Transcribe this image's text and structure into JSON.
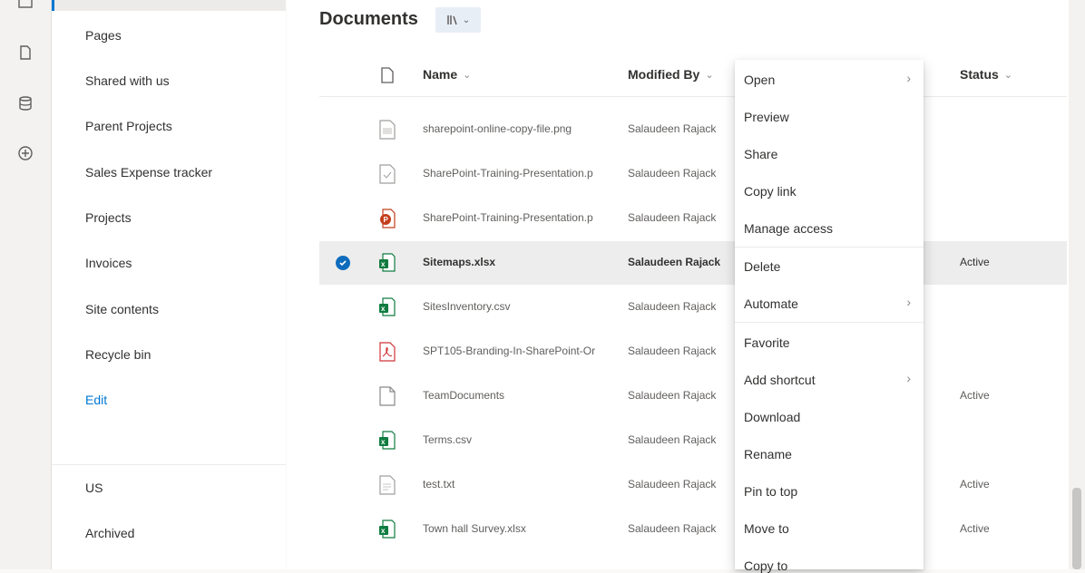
{
  "leftnav": {
    "items": [
      {
        "label": "Pages"
      },
      {
        "label": "Shared with us"
      },
      {
        "label": "Parent Projects"
      },
      {
        "label": "Sales Expense tracker"
      },
      {
        "label": "Projects"
      },
      {
        "label": "Invoices"
      },
      {
        "label": "Site contents"
      },
      {
        "label": "Recycle bin"
      },
      {
        "label": "Edit"
      }
    ],
    "bottom_items": [
      {
        "label": "US"
      },
      {
        "label": "Archived"
      }
    ]
  },
  "library": {
    "title": "Documents",
    "columns": {
      "name": "Name",
      "modified_by": "Modified By",
      "status": "Status"
    },
    "rows": [
      {
        "name": "sharepoint-online-copy-file.png",
        "modified_by": "Salaudeen Rajack",
        "status": "",
        "icon": "image-file-icon"
      },
      {
        "name": "SharePoint-Training-Presentation.p",
        "modified_by": "Salaudeen Rajack",
        "status": "",
        "icon": "file-icon"
      },
      {
        "name": "SharePoint-Training-Presentation.p",
        "modified_by": "Salaudeen Rajack",
        "status": "",
        "icon": "powerpoint-file-icon"
      },
      {
        "name": "Sitemaps.xlsx",
        "modified_by": "Salaudeen Rajack",
        "status": "Active",
        "icon": "excel-file-icon",
        "selected": true
      },
      {
        "name": "SitesInventory.csv",
        "modified_by": "Salaudeen Rajack",
        "status": "",
        "icon": "excel-file-icon"
      },
      {
        "name": "SPT105-Branding-In-SharePoint-Or",
        "modified_by": "Salaudeen Rajack",
        "status": "",
        "icon": "pdf-file-icon"
      },
      {
        "name": "TeamDocuments",
        "modified_by": "Salaudeen Rajack",
        "status": "Active",
        "icon": "document-icon"
      },
      {
        "name": "Terms.csv",
        "modified_by": "Salaudeen Rajack",
        "status": "",
        "icon": "excel-file-icon"
      },
      {
        "name": "test.txt",
        "modified_by": "Salaudeen Rajack",
        "status": "Active",
        "icon": "text-file-icon"
      },
      {
        "name": "Town hall Survey.xlsx",
        "modified_by": "Salaudeen Rajack",
        "status": "Active",
        "icon": "excel-file-icon"
      }
    ]
  },
  "context_menu": {
    "items": [
      {
        "label": "Open",
        "submenu": true
      },
      {
        "label": "Preview"
      },
      {
        "label": "Share"
      },
      {
        "label": "Copy link"
      },
      {
        "label": "Manage access"
      },
      {
        "label": "Delete"
      },
      {
        "label": "Automate",
        "submenu": true
      },
      {
        "label": "Favorite"
      },
      {
        "label": "Add shortcut",
        "submenu": true
      },
      {
        "label": "Download"
      },
      {
        "label": "Rename"
      },
      {
        "label": "Pin to top"
      },
      {
        "label": "Move to"
      },
      {
        "label": "Copy to"
      }
    ]
  },
  "colors": {
    "accent": "#0078d4",
    "excel": "#107c41",
    "powerpoint": "#c43e1c",
    "pdf": "#d13438"
  }
}
